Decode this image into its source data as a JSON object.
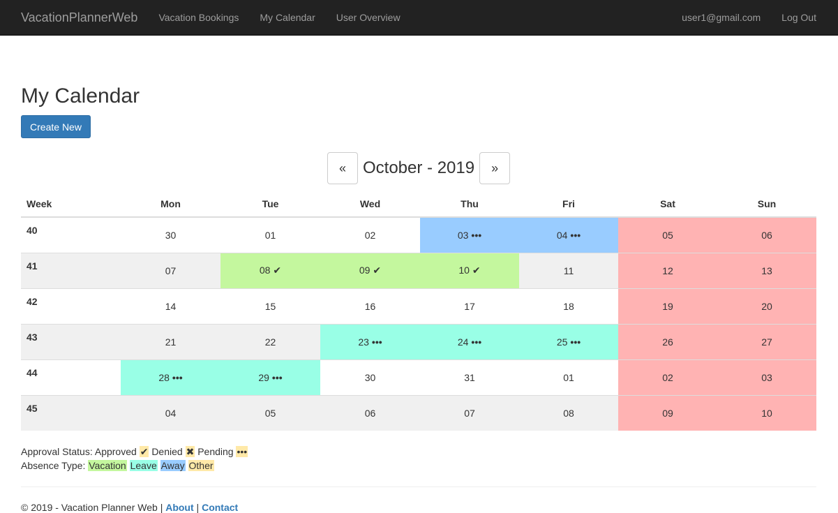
{
  "nav": {
    "brand": "VacationPlannerWeb",
    "links": [
      "Vacation Bookings",
      "My Calendar",
      "User Overview"
    ],
    "user": "user1@gmail.com",
    "logout": "Log Out"
  },
  "page": {
    "title": "My Calendar",
    "create_button": "Create New"
  },
  "calendar": {
    "prev": "«",
    "next": "»",
    "month_label": "October - 2019",
    "headers": [
      "Week",
      "Mon",
      "Tue",
      "Wed",
      "Thu",
      "Fri",
      "Sat",
      "Sun"
    ],
    "weeks": [
      {
        "week": "40",
        "days": [
          {
            "d": "30",
            "type": "",
            "status": ""
          },
          {
            "d": "01",
            "type": "",
            "status": ""
          },
          {
            "d": "02",
            "type": "",
            "status": ""
          },
          {
            "d": "03",
            "type": "away",
            "status": "pending"
          },
          {
            "d": "04",
            "type": "away",
            "status": "pending"
          },
          {
            "d": "05",
            "type": "weekend",
            "status": ""
          },
          {
            "d": "06",
            "type": "weekend",
            "status": ""
          }
        ]
      },
      {
        "week": "41",
        "days": [
          {
            "d": "07",
            "type": "",
            "status": ""
          },
          {
            "d": "08",
            "type": "vacation",
            "status": "approved"
          },
          {
            "d": "09",
            "type": "vacation",
            "status": "approved"
          },
          {
            "d": "10",
            "type": "vacation",
            "status": "approved"
          },
          {
            "d": "11",
            "type": "",
            "status": ""
          },
          {
            "d": "12",
            "type": "weekend",
            "status": ""
          },
          {
            "d": "13",
            "type": "weekend",
            "status": ""
          }
        ]
      },
      {
        "week": "42",
        "days": [
          {
            "d": "14",
            "type": "",
            "status": ""
          },
          {
            "d": "15",
            "type": "",
            "status": ""
          },
          {
            "d": "16",
            "type": "",
            "status": ""
          },
          {
            "d": "17",
            "type": "",
            "status": ""
          },
          {
            "d": "18",
            "type": "",
            "status": ""
          },
          {
            "d": "19",
            "type": "weekend",
            "status": ""
          },
          {
            "d": "20",
            "type": "weekend",
            "status": ""
          }
        ]
      },
      {
        "week": "43",
        "days": [
          {
            "d": "21",
            "type": "",
            "status": ""
          },
          {
            "d": "22",
            "type": "",
            "status": ""
          },
          {
            "d": "23",
            "type": "leave",
            "status": "pending"
          },
          {
            "d": "24",
            "type": "leave",
            "status": "pending"
          },
          {
            "d": "25",
            "type": "leave",
            "status": "pending"
          },
          {
            "d": "26",
            "type": "weekend",
            "status": ""
          },
          {
            "d": "27",
            "type": "weekend",
            "status": ""
          }
        ]
      },
      {
        "week": "44",
        "days": [
          {
            "d": "28",
            "type": "leave",
            "status": "pending"
          },
          {
            "d": "29",
            "type": "leave",
            "status": "pending"
          },
          {
            "d": "30",
            "type": "",
            "status": ""
          },
          {
            "d": "31",
            "type": "",
            "status": ""
          },
          {
            "d": "01",
            "type": "",
            "status": ""
          },
          {
            "d": "02",
            "type": "weekend",
            "status": ""
          },
          {
            "d": "03",
            "type": "weekend",
            "status": ""
          }
        ]
      },
      {
        "week": "45",
        "days": [
          {
            "d": "04",
            "type": "",
            "status": ""
          },
          {
            "d": "05",
            "type": "",
            "status": ""
          },
          {
            "d": "06",
            "type": "",
            "status": ""
          },
          {
            "d": "07",
            "type": "",
            "status": ""
          },
          {
            "d": "08",
            "type": "",
            "status": ""
          },
          {
            "d": "09",
            "type": "weekend",
            "status": ""
          },
          {
            "d": "10",
            "type": "weekend",
            "status": ""
          }
        ]
      }
    ],
    "status_icons": {
      "approved": "check-icon",
      "denied": "cross-icon",
      "pending": "ellipsis-icon"
    },
    "colors": {
      "vacation": "#c4f79e",
      "leave": "#99ffe6",
      "away": "#99ccff",
      "other": "#ffe9a8",
      "weekend": "#ffb3b3",
      "primary": "#337ab7"
    }
  },
  "legend": {
    "status_label": "Approval Status:",
    "approved": "Approved",
    "denied": "Denied",
    "pending": "Pending",
    "type_label": "Absence Type:",
    "vacation": "Vacation",
    "leave": "Leave",
    "away": "Away",
    "other": "Other"
  },
  "footer": {
    "copyright": "© 2019 - Vacation Planner Web |",
    "about": "About",
    "sep": "|",
    "contact": "Contact"
  }
}
